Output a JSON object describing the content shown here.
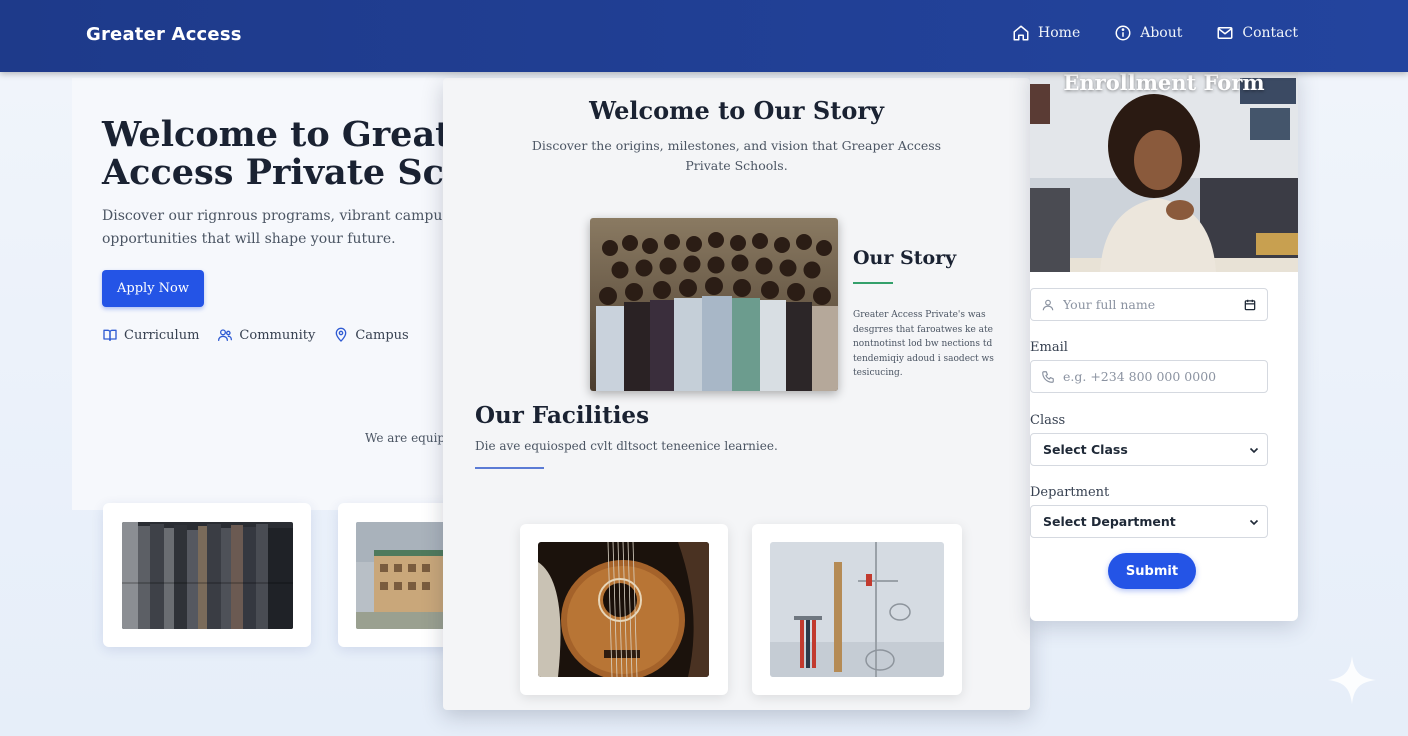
{
  "nav": {
    "brand": "Greater Access",
    "links": [
      {
        "label": "Home",
        "icon": "home-icon"
      },
      {
        "label": "About",
        "icon": "info-icon"
      },
      {
        "label": "Contact",
        "icon": "mail-icon"
      }
    ]
  },
  "hero": {
    "title_line1": "Welcome to Greater",
    "title_line2": "Access Private Scho",
    "subtitle_line1": "Discover our rignrous programs, vibrant campus lif",
    "subtitle_line2": "opportunities that will shape your future.",
    "apply_label": "Apply Now",
    "features": [
      {
        "label": "Curriculum",
        "icon": "book-icon"
      },
      {
        "label": "Community",
        "icon": "users-icon"
      },
      {
        "label": "Campus",
        "icon": "map-pin-icon"
      }
    ],
    "equip_text": "We are equip"
  },
  "story": {
    "heading": "Welcome to Our Story",
    "subtitle": "Discover the origins, milestones, and vision that Greaper Access Private Schools.",
    "our_story_title": "Our Story",
    "our_story_text": "Greater Access Private's was desgrres that faroatwes ke ate nontnotinst lod bw nections td tendemiqiy adoud i saodect ws tesicucing.",
    "facilities_title": "Our Facilities",
    "facilities_subtitle": "Die ave equiosped cvlt dltsoct teneenice learniee."
  },
  "form": {
    "title": "Enrollment Form",
    "name_placeholder": "Your full name",
    "email_label": "Email",
    "phone_placeholder": "e.g. +234 800 000 0000",
    "class_label": "Class",
    "class_selected": "Select Class",
    "department_label": "Department",
    "department_selected": "Select Department",
    "submit_label": "Submit"
  },
  "colors": {
    "nav_bg": "#1e3a8a",
    "primary": "#2454e6",
    "accent_green": "#34a06b",
    "heading": "#1a2232"
  }
}
